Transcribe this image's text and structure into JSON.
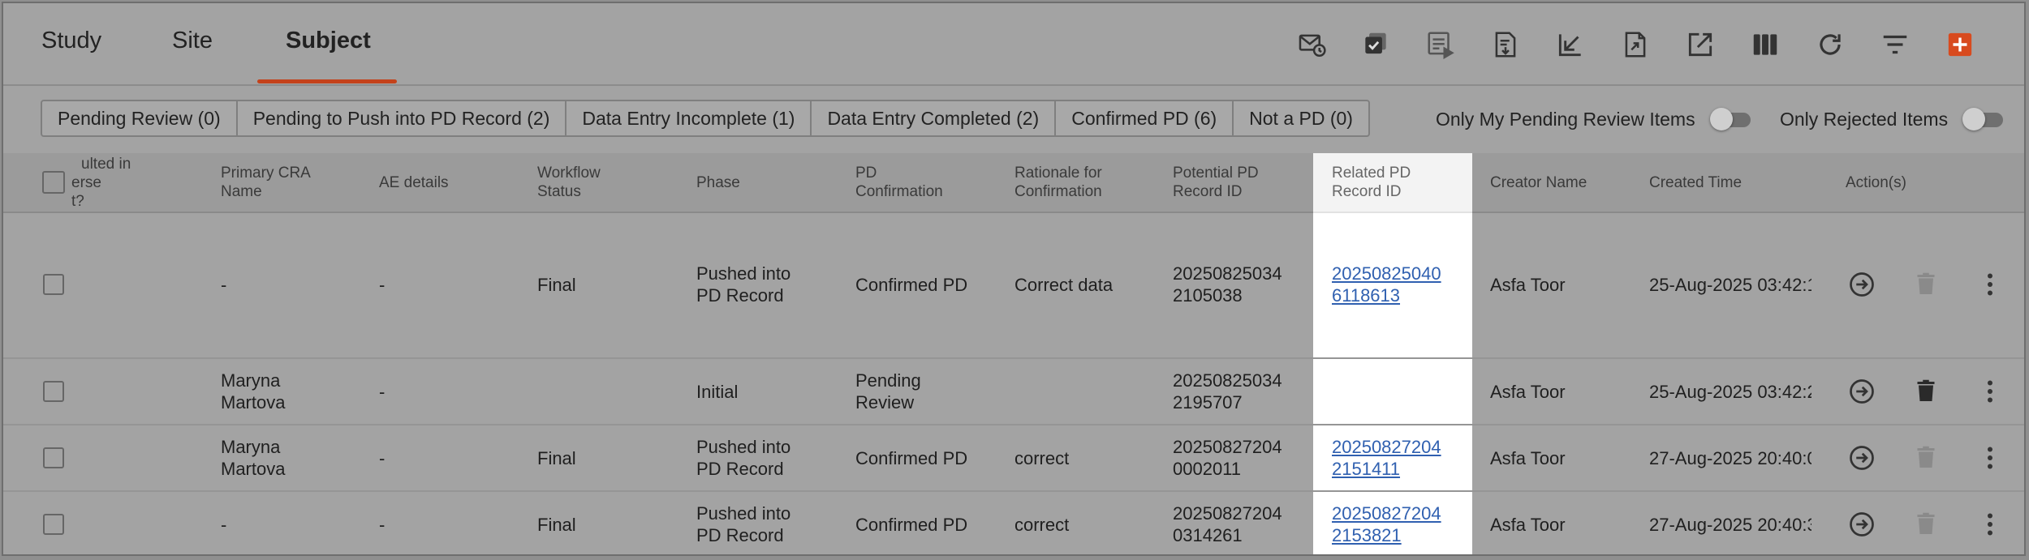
{
  "tabs": [
    {
      "label": "Study"
    },
    {
      "label": "Site"
    },
    {
      "label": "Subject"
    }
  ],
  "toolbar_icons": [
    "mail-clock-icon",
    "copy-check-icon",
    "list-play-icon",
    "document-download-icon",
    "arrow-down-left-icon",
    "document-export-icon",
    "open-external-icon",
    "columns-icon",
    "refresh-icon",
    "filter-icon",
    "add-icon"
  ],
  "filters": {
    "chips": [
      {
        "label": "Pending Review (0)"
      },
      {
        "label": "Pending to Push into PD Record (2)"
      },
      {
        "label": "Data Entry Incomplete (1)"
      },
      {
        "label": "Data Entry Completed (2)"
      },
      {
        "label": "Confirmed PD (6)"
      },
      {
        "label": "Not a PD (0)"
      }
    ],
    "only_my_pending_label": "Only My Pending Review Items",
    "only_rejected_label": "Only Rejected Items"
  },
  "table": {
    "columns": {
      "resulted_l1": "ulted in",
      "resulted_l2": "erse",
      "resulted_l3": "t?",
      "cra_l1": "Primary CRA",
      "cra_l2": "Name",
      "ae": "AE details",
      "wf_l1": "Workflow",
      "wf_l2": "Status",
      "phase": "Phase",
      "pdc_l1": "PD",
      "pdc_l2": "Confirmation",
      "rat_l1": "Rationale for",
      "rat_l2": "Confirmation",
      "ppd_l1": "Potential PD",
      "ppd_l2": "Record ID",
      "rpd_l1": "Related PD",
      "rpd_l2": "Record ID",
      "creator": "Creator Name",
      "created": "Created Time",
      "actions": "Action(s)"
    },
    "rows": [
      {
        "cra_l1": "-",
        "cra_l2": "",
        "ae": "-",
        "wf": "Final",
        "phase_l1": "Pushed into",
        "phase_l2": "PD Record",
        "pdc_l1": "Confirmed PD",
        "pdc_l2": "",
        "rat": "Correct data",
        "ppd_l1": "20250825034",
        "ppd_l2": "2105038",
        "rpd_l1": "20250825040",
        "rpd_l2": "6118613",
        "creator": "Asfa Toor",
        "created": "25-Aug-2025 03:42:1(",
        "delete_enabled": false
      },
      {
        "cra_l1": "Maryna",
        "cra_l2": "Martova",
        "ae": "-",
        "wf": "",
        "phase_l1": "Initial",
        "phase_l2": "",
        "pdc_l1": "Pending",
        "pdc_l2": "Review",
        "rat": "",
        "ppd_l1": "20250825034",
        "ppd_l2": "2195707",
        "rpd_l1": "",
        "rpd_l2": "",
        "creator": "Asfa Toor",
        "created": "25-Aug-2025 03:42:2(",
        "delete_enabled": true
      },
      {
        "cra_l1": "Maryna",
        "cra_l2": "Martova",
        "ae": "-",
        "wf": "Final",
        "phase_l1": "Pushed into",
        "phase_l2": "PD Record",
        "pdc_l1": "Confirmed PD",
        "pdc_l2": "",
        "rat": "correct",
        "ppd_l1": "20250827204",
        "ppd_l2": "0002011",
        "rpd_l1": "20250827204",
        "rpd_l2": "2151411",
        "creator": "Asfa Toor",
        "created": "27-Aug-2025 20:40:0(",
        "delete_enabled": false
      },
      {
        "cra_l1": "-",
        "cra_l2": "",
        "ae": "-",
        "wf": "Final",
        "phase_l1": "Pushed into",
        "phase_l2": "PD Record",
        "pdc_l1": "Confirmed PD",
        "pdc_l2": "",
        "rat": "correct",
        "ppd_l1": "20250827204",
        "ppd_l2": "0314261",
        "rpd_l1": "20250827204",
        "rpd_l2": "2153821",
        "creator": "Asfa Toor",
        "created": "27-Aug-2025 20:40:3:",
        "delete_enabled": false
      }
    ]
  },
  "colors": {
    "accent": "#c4421b",
    "link": "#3060b0",
    "add_button": "#d84a1e"
  }
}
